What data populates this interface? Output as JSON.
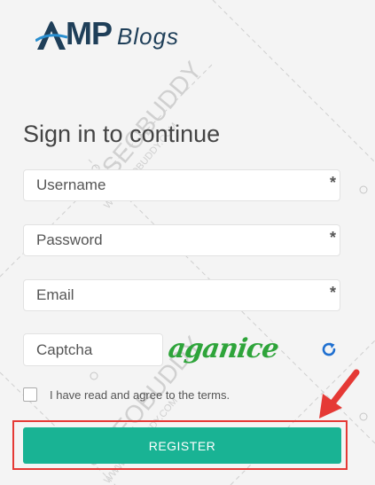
{
  "logo": {
    "amp": "MP",
    "blogs": "Blogs"
  },
  "form": {
    "title": "Sign in to continue",
    "fields": [
      {
        "placeholder": "Username",
        "required_mark": "*"
      },
      {
        "placeholder": "Password",
        "required_mark": "*"
      },
      {
        "placeholder": "Email",
        "required_mark": "*"
      }
    ],
    "captcha_placeholder": "Captcha",
    "captcha_text": "aganice",
    "terms_label": "I have read and agree to the terms.",
    "register_label": "REGISTER"
  },
  "watermark": {
    "text": "SEOBUDDY",
    "url": "WWW.SEOBUDDY.COM"
  },
  "colors": {
    "brand": "#1f3f59",
    "primary_button": "#19b394",
    "captcha": "#2ea43a",
    "refresh_icon": "#1e6fd0",
    "highlight": "#e53935"
  },
  "icons": {
    "refresh": "refresh-icon",
    "arrow": "arrow-annotation-icon"
  }
}
